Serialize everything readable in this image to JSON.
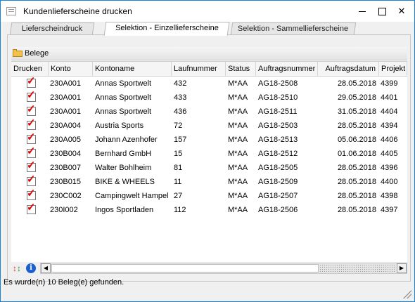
{
  "window": {
    "title": "Kundenlieferscheine drucken"
  },
  "tabs": [
    {
      "label": "Lieferscheindruck",
      "active": false
    },
    {
      "label": "Selektion - Einzellieferscheine",
      "active": true
    },
    {
      "label": "Selektion - Sammellieferscheine",
      "active": false
    }
  ],
  "group": {
    "label": "Belege",
    "icon": "folder-icon"
  },
  "table": {
    "columns": [
      "Drucken",
      "Konto",
      "Kontoname",
      "Laufnummer",
      "Status",
      "Auftragsnummer",
      "Auftragsdatum",
      "Projekt"
    ],
    "rows": [
      {
        "drucken": true,
        "konto": "230A001",
        "kontoname": "Annas Sportwelt",
        "laufnummer": "432",
        "status": "M*AA",
        "auftragsnummer": "AG18-2508",
        "auftragsdatum": "28.05.2018",
        "projekt": "4399"
      },
      {
        "drucken": true,
        "konto": "230A001",
        "kontoname": "Annas Sportwelt",
        "laufnummer": "433",
        "status": "M*AA",
        "auftragsnummer": "AG18-2510",
        "auftragsdatum": "29.05.2018",
        "projekt": "4401"
      },
      {
        "drucken": true,
        "konto": "230A001",
        "kontoname": "Annas Sportwelt",
        "laufnummer": "436",
        "status": "M*AA",
        "auftragsnummer": "AG18-2511",
        "auftragsdatum": "31.05.2018",
        "projekt": "4404"
      },
      {
        "drucken": true,
        "konto": "230A004",
        "kontoname": "Austria Sports",
        "laufnummer": "72",
        "status": "M*AA",
        "auftragsnummer": "AG18-2503",
        "auftragsdatum": "28.05.2018",
        "projekt": "4394"
      },
      {
        "drucken": true,
        "konto": "230A005",
        "kontoname": "Johann Azenhofer",
        "laufnummer": "157",
        "status": "M*AA",
        "auftragsnummer": "AG18-2513",
        "auftragsdatum": "05.06.2018",
        "projekt": "4406"
      },
      {
        "drucken": true,
        "konto": "230B004",
        "kontoname": "Bernhard GmbH",
        "laufnummer": "15",
        "status": "M*AA",
        "auftragsnummer": "AG18-2512",
        "auftragsdatum": "01.06.2018",
        "projekt": "4405"
      },
      {
        "drucken": true,
        "konto": "230B007",
        "kontoname": "Walter Bohlheim",
        "laufnummer": "81",
        "status": "M*AA",
        "auftragsnummer": "AG18-2505",
        "auftragsdatum": "28.05.2018",
        "projekt": "4396"
      },
      {
        "drucken": true,
        "konto": "230B015",
        "kontoname": "BIKE & WHEELS",
        "laufnummer": "11",
        "status": "M*AA",
        "auftragsnummer": "AG18-2509",
        "auftragsdatum": "28.05.2018",
        "projekt": "4400"
      },
      {
        "drucken": true,
        "konto": "230C002",
        "kontoname": "Campingwelt Hampel",
        "laufnummer": "27",
        "status": "M*AA",
        "auftragsnummer": "AG18-2507",
        "auftragsdatum": "28.05.2018",
        "projekt": "4398"
      },
      {
        "drucken": true,
        "konto": "230I002",
        "kontoname": "Ingos Sportladen",
        "laufnummer": "112",
        "status": "M*AA",
        "auftragsnummer": "AG18-2506",
        "auftragsdatum": "28.05.2018",
        "projekt": "4397"
      }
    ]
  },
  "toolbar": {
    "icons": [
      "swap-icon",
      "info-icon"
    ]
  },
  "status": {
    "text": "Es wurde(n) 10 Beleg(e) gefunden."
  },
  "colors": {
    "accent": "#1883d7",
    "check": "#e00000",
    "folder": "#f2c14c"
  }
}
